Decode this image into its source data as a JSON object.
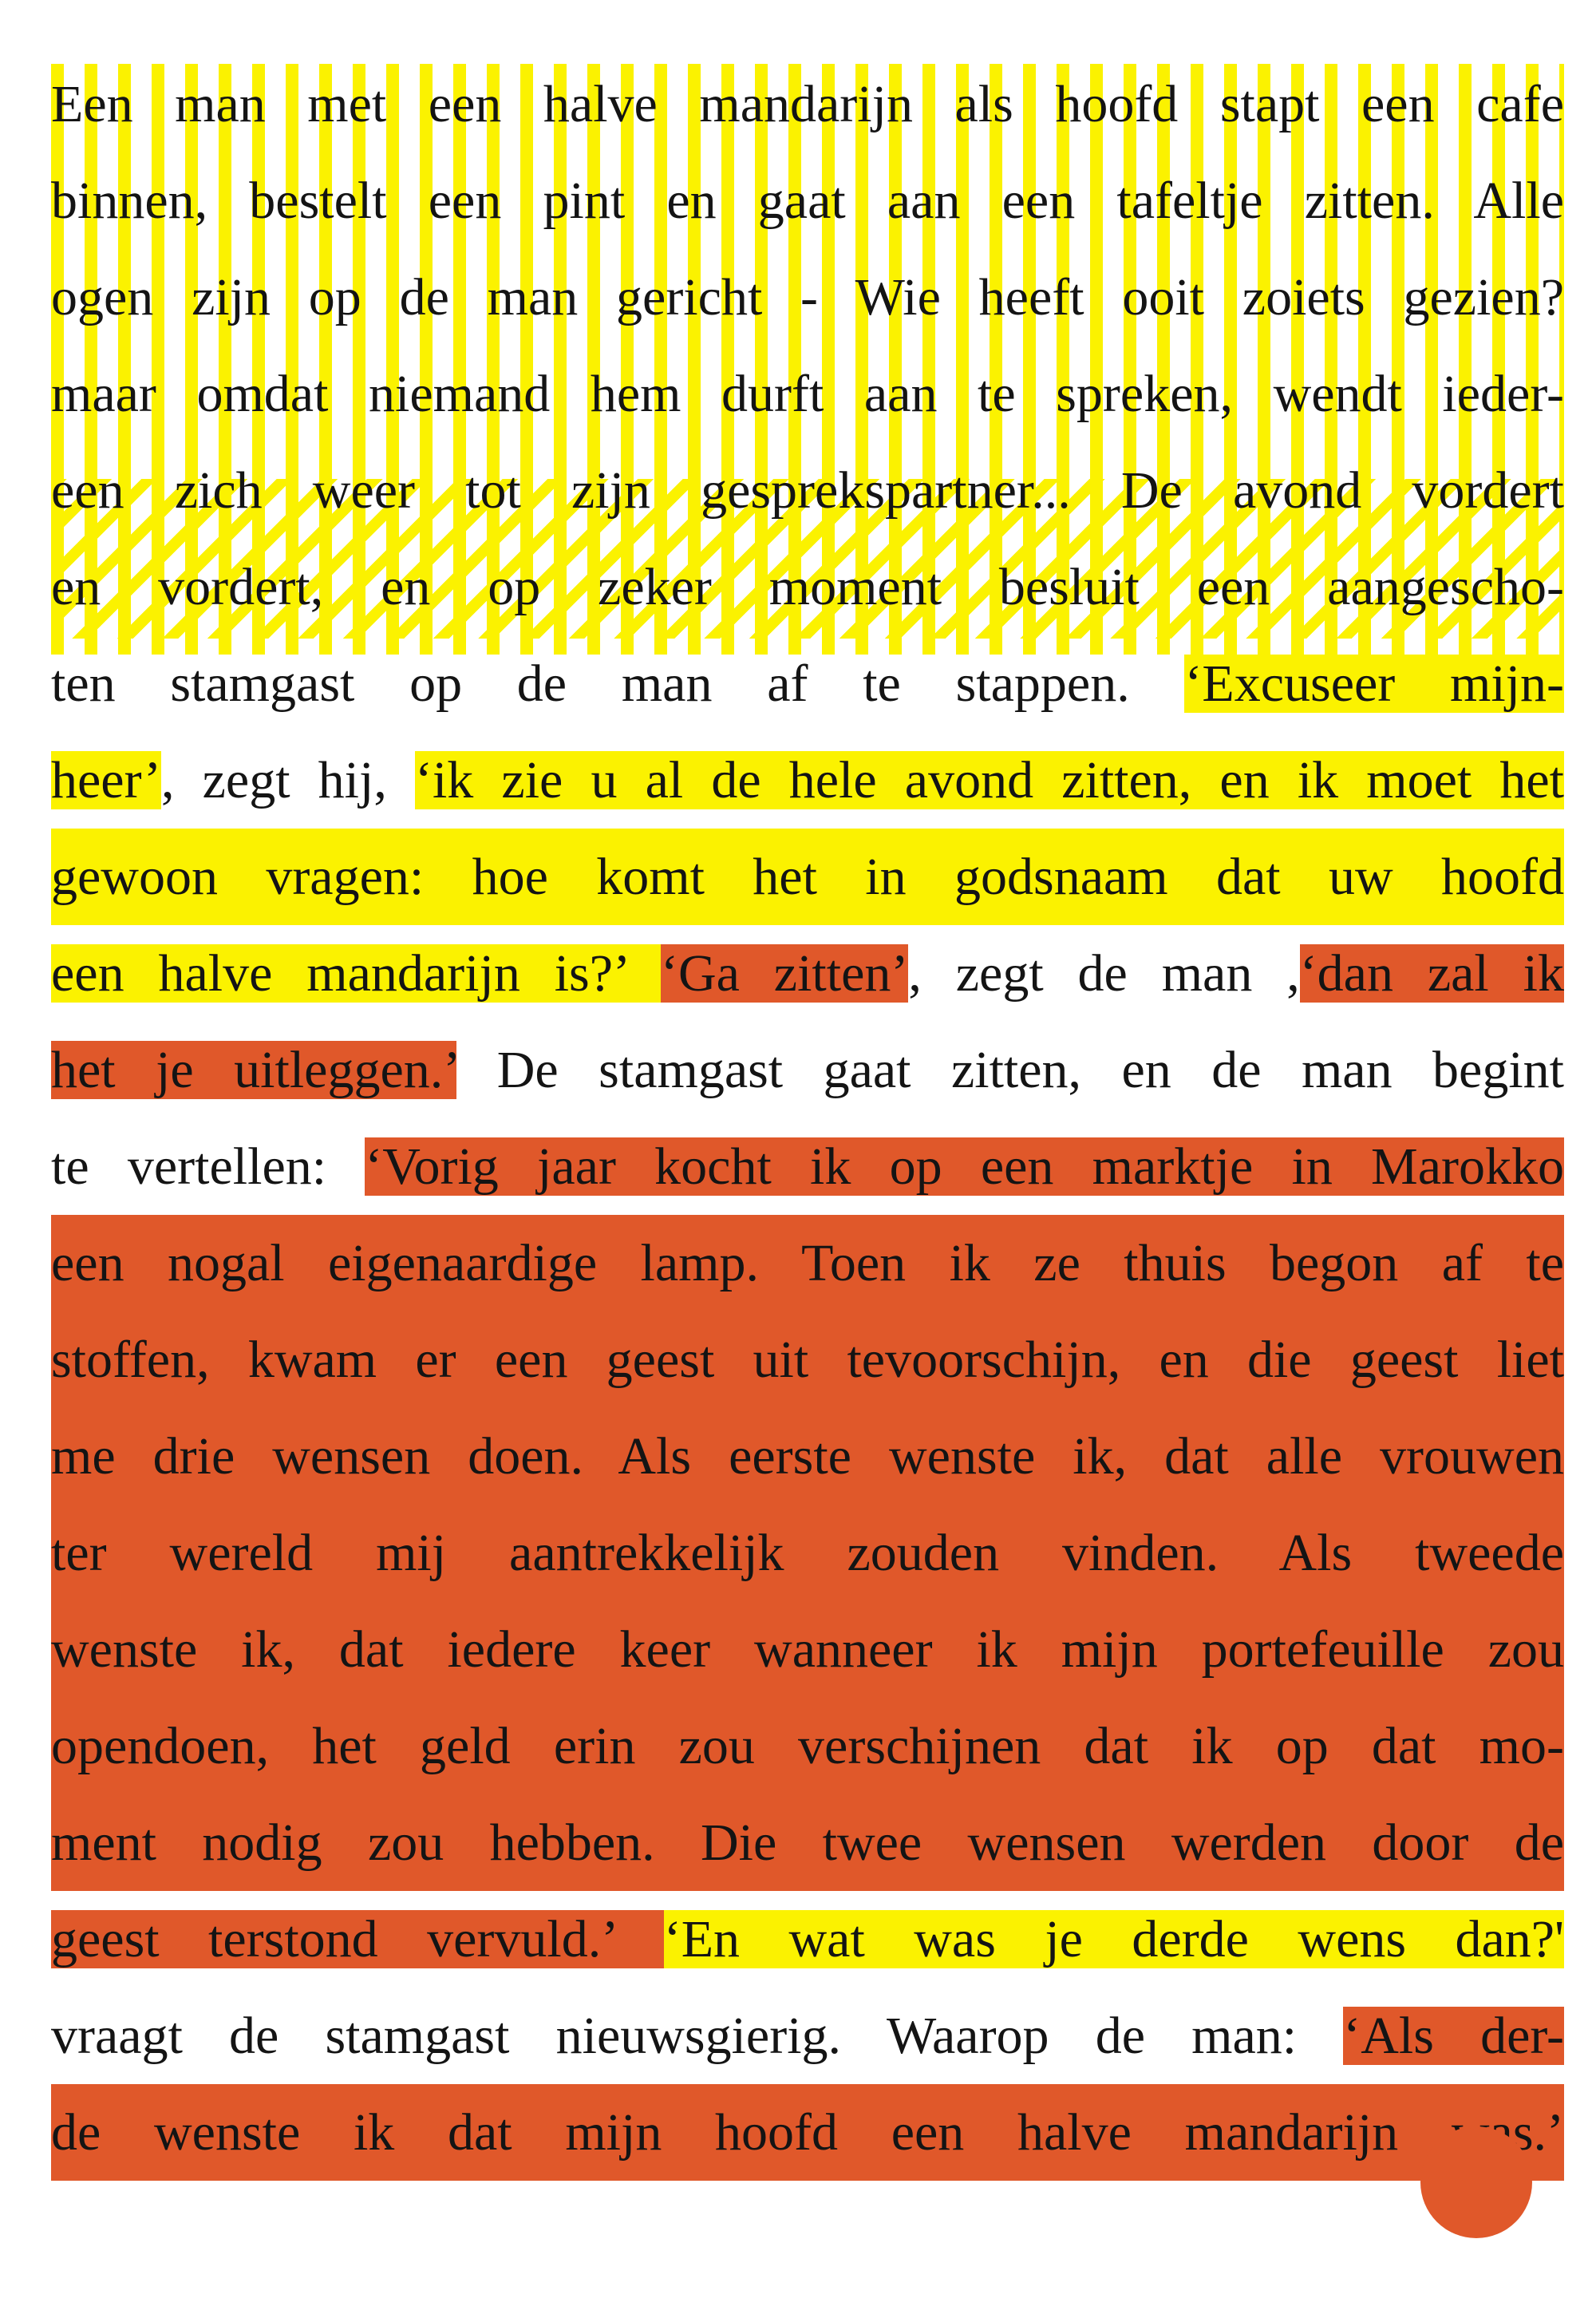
{
  "colors": {
    "highlight_yellow": "#fbf200",
    "highlight_orange": "#e0582a",
    "text": "#141414",
    "background": "#ffffff"
  },
  "lines": [
    [
      "Een man met een halve mandarijn als hoofd stapt een cafe"
    ],
    [
      "binnen, bestelt een pint en gaat aan een tafeltje zitten. Alle"
    ],
    [
      "ogen zijn op de man gericht - Wie heeft ooit zoiets gezien?"
    ],
    [
      "maar omdat niemand hem durft aan te spreken, wendt ieder-"
    ],
    [
      "een zich weer tot zijn gesprekspartner... De avond vordert"
    ],
    [
      "en vordert, en op zeker moment besluit een aangescho-"
    ],
    [
      "ten stamgast op de man af te stappen. ",
      "‘Excuseer mijn-"
    ],
    [
      "heer’",
      ", zegt hij, ",
      "‘ik zie u al de hele avond zitten, en ik moet het"
    ],
    [
      "gewoon vragen: hoe komt het in godsnaam dat uw hoofd"
    ],
    [
      "een halve mandarijn is?’ ",
      "‘Ga zitten’",
      ", zegt de man ,",
      "‘dan zal ik"
    ],
    [
      "het je uitleggen.’",
      " De stamgast gaat zitten, en de man begint"
    ],
    [
      "te vertellen: ",
      "‘Vorig jaar kocht ik op een marktje in Marokko"
    ],
    [
      "een nogal eigenaardige lamp. Toen ik ze thuis begon af te"
    ],
    [
      "stoffen, kwam er een geest uit tevoorschijn, en die geest liet"
    ],
    [
      "me drie wensen doen. Als eerste wenste ik, dat alle vrouwen"
    ],
    [
      "ter wereld mij aantrekkelijk zouden vinden. Als tweede"
    ],
    [
      "wenste ik, dat iedere keer wanneer ik mijn portefeuille zou"
    ],
    [
      "opendoen, het geld erin zou verschijnen dat ik op dat mo-"
    ],
    [
      "ment nodig zou hebben. Die twee wensen werden door de"
    ],
    [
      "geest terstond vervuld.’ ",
      "‘En wat was je derde wens dan?'"
    ],
    [
      "vraagt de stamgast nieuwsgierig. Waarop de man: ",
      "‘Als der-"
    ],
    [
      "de wenste ik dat mijn hoofd een halve mandarijn was.’"
    ]
  ]
}
